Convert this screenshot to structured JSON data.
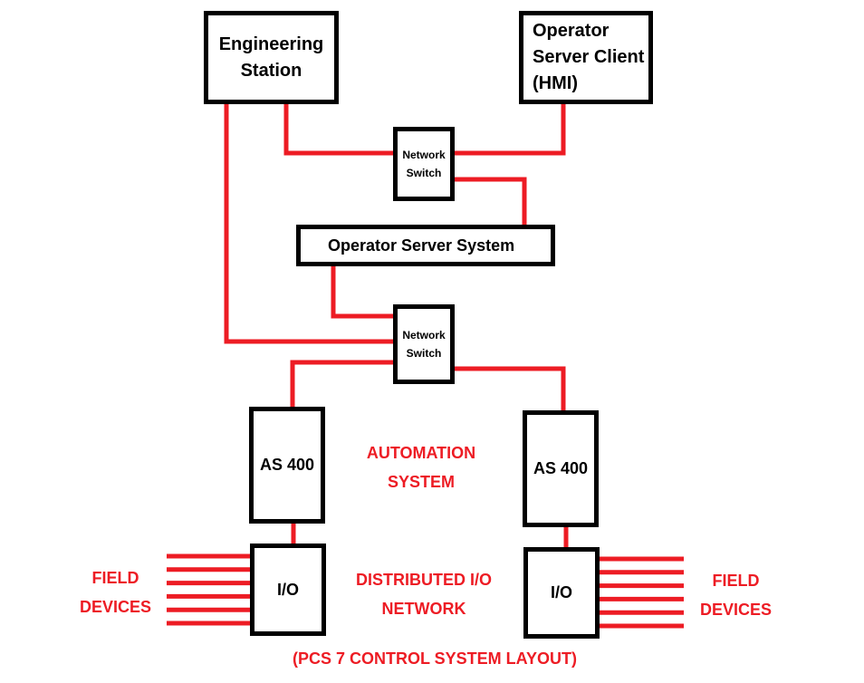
{
  "diagram": {
    "title": "(PCS 7 CONTROL SYSTEM LAYOUT)",
    "wire_color": "#ED1C24",
    "nodes": {
      "engineering_station": "Engineering\nStation",
      "hmi": "Operator\nServer Client\n(HMI)",
      "switch_top": "Network\nSwitch",
      "operator_server_system": "Operator Server System",
      "switch_bottom": "Network\nSwitch",
      "as_left": "AS 400",
      "as_right": "AS 400",
      "io_left": "I/O",
      "io_right": "I/O"
    },
    "labels": {
      "automation_system": "AUTOMATION\nSYSTEM",
      "distributed_io": "DISTRIBUTED I/O\nNETWORK",
      "field_devices_left": "FIELD\nDEVICES",
      "field_devices_right": "FIELD\nDEVICES"
    },
    "field_device_lines_per_io": 6
  }
}
